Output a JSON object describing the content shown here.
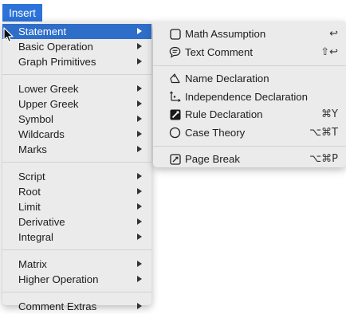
{
  "menubar": {
    "title": "Insert"
  },
  "main_menu": {
    "groups": [
      [
        {
          "label": "Statement",
          "submenu": true,
          "selected": true
        },
        {
          "label": "Basic Operation",
          "submenu": true
        },
        {
          "label": "Graph Primitives",
          "submenu": true
        }
      ],
      [
        {
          "label": "Lower Greek",
          "submenu": true
        },
        {
          "label": "Upper Greek",
          "submenu": true
        },
        {
          "label": "Symbol",
          "submenu": true
        },
        {
          "label": "Wildcards",
          "submenu": true
        },
        {
          "label": "Marks",
          "submenu": true
        }
      ],
      [
        {
          "label": "Script",
          "submenu": true
        },
        {
          "label": "Root",
          "submenu": true
        },
        {
          "label": "Limit",
          "submenu": true
        },
        {
          "label": "Derivative",
          "submenu": true
        },
        {
          "label": "Integral",
          "submenu": true
        }
      ],
      [
        {
          "label": "Matrix",
          "submenu": true
        },
        {
          "label": "Higher Operation",
          "submenu": true
        }
      ],
      [
        {
          "label": "Comment Extras",
          "submenu": true
        }
      ]
    ]
  },
  "statement_submenu": {
    "groups": [
      [
        {
          "label": "Math Assumption",
          "icon": "square-outline-icon",
          "shortcut": "↩"
        },
        {
          "label": "Text Comment",
          "icon": "speech-bubble-icon",
          "shortcut": "⇧↩"
        }
      ],
      [
        {
          "label": "Name Declaration",
          "icon": "delta-tag-icon",
          "shortcut": ""
        },
        {
          "label": "Independence Declaration",
          "icon": "axes-icon",
          "shortcut": ""
        },
        {
          "label": "Rule Declaration",
          "icon": "ruler-square-icon",
          "shortcut": "⌘Y"
        },
        {
          "label": "Case Theory",
          "icon": "circle-outline-icon",
          "shortcut": "⌥⌘T"
        }
      ],
      [
        {
          "label": "Page Break",
          "icon": "page-break-icon",
          "shortcut": "⌥⌘P"
        }
      ]
    ]
  }
}
